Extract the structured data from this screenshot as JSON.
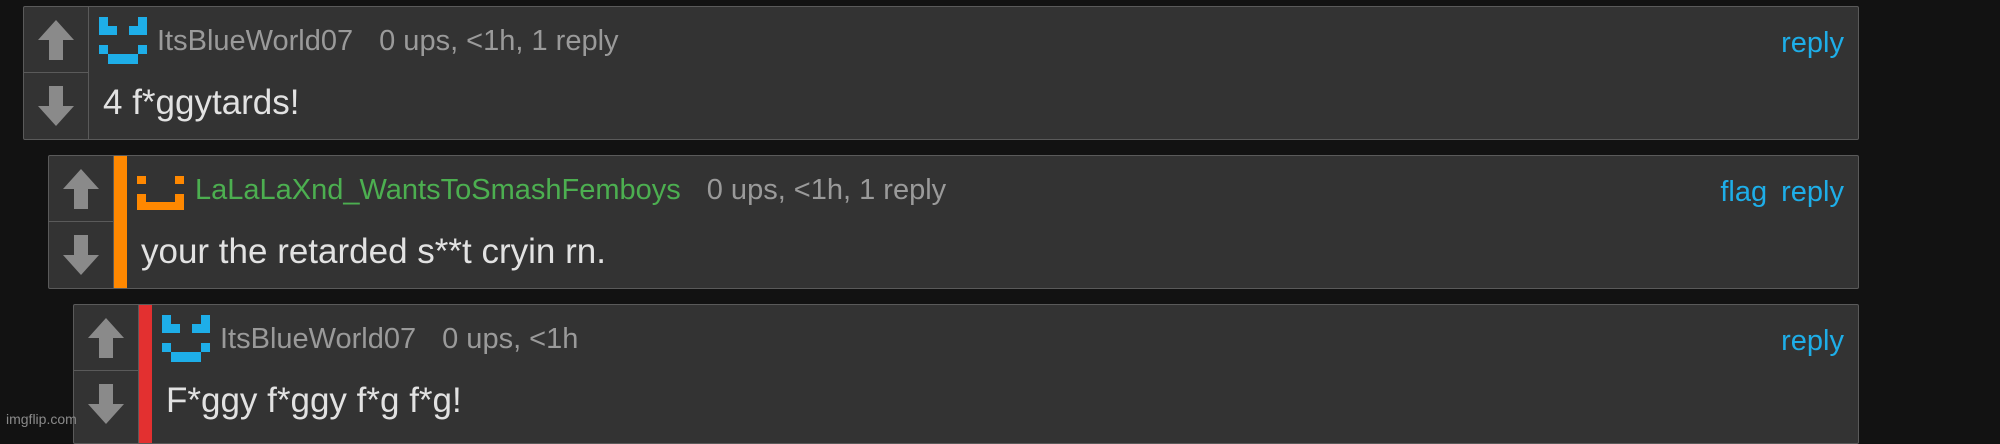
{
  "colors": {
    "background": "#121212",
    "panel": "#333333",
    "border": "#5a5a5a",
    "link": "#1eaee8",
    "meta": "#9a9a9a",
    "body_text": "#e2e2e2"
  },
  "comments": [
    {
      "username": "ItsBlueWorld07",
      "username_color": "#9a9a9a",
      "meta": "0 ups, <1h, 1 reply",
      "text": "4 f*ggytards!",
      "flag_label": "",
      "reply_label": "reply",
      "avatar_icon": "blue-pixel-smiley-icon",
      "stripe_color": ""
    },
    {
      "username": "LaLaLaXnd_WantsToSmashFemboys",
      "username_color": "#4caf50",
      "meta": "0 ups, <1h, 1 reply",
      "text": "your the retarded s**t cryin rn.",
      "flag_label": "flag",
      "reply_label": "reply",
      "avatar_icon": "orange-pixel-face-icon",
      "stripe_color": "#ff8800"
    },
    {
      "username": "ItsBlueWorld07",
      "username_color": "#9a9a9a",
      "meta": "0 ups, <1h",
      "text": "F*ggy f*ggy f*g f*g!",
      "flag_label": "",
      "reply_label": "reply",
      "avatar_icon": "blue-pixel-smiley-icon",
      "stripe_color": "#e33030"
    }
  ],
  "watermark": "imgflip.com"
}
